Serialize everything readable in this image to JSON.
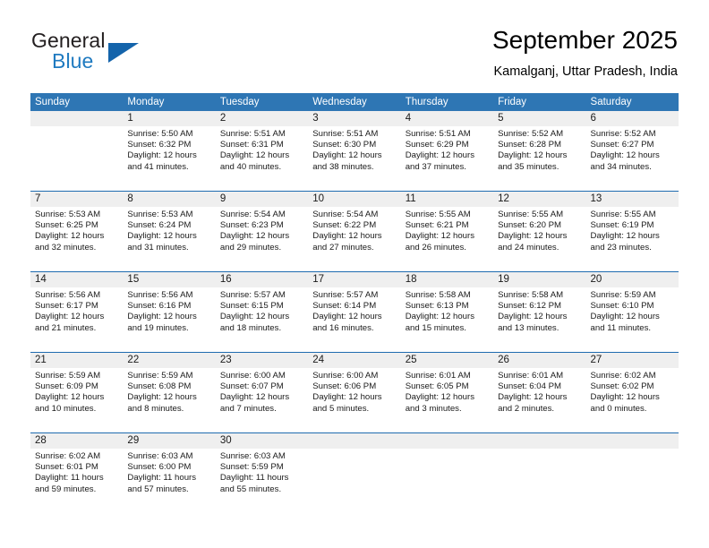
{
  "brand": {
    "name_part1": "General",
    "name_part2": "Blue",
    "triangle_icon": "triangle-logo-icon",
    "accent_color": "#1464ab",
    "blue_text_color": "#1f7ac0"
  },
  "header": {
    "title": "September 2025",
    "location": "Kamalganj, Uttar Pradesh, India"
  },
  "theme": {
    "header_band_color": "#2e76b4",
    "row_divider_color": "#1f6cb0",
    "daynum_strip_color": "#efefef",
    "text_color": "#1a1a1a"
  },
  "weekdays": [
    "Sunday",
    "Monday",
    "Tuesday",
    "Wednesday",
    "Thursday",
    "Friday",
    "Saturday"
  ],
  "weeks": [
    [
      {
        "day": "",
        "sunrise": "",
        "sunset": "",
        "daylight": "",
        "empty": true
      },
      {
        "day": "1",
        "sunrise": "Sunrise: 5:50 AM",
        "sunset": "Sunset: 6:32 PM",
        "daylight": "Daylight: 12 hours and 41 minutes."
      },
      {
        "day": "2",
        "sunrise": "Sunrise: 5:51 AM",
        "sunset": "Sunset: 6:31 PM",
        "daylight": "Daylight: 12 hours and 40 minutes."
      },
      {
        "day": "3",
        "sunrise": "Sunrise: 5:51 AM",
        "sunset": "Sunset: 6:30 PM",
        "daylight": "Daylight: 12 hours and 38 minutes."
      },
      {
        "day": "4",
        "sunrise": "Sunrise: 5:51 AM",
        "sunset": "Sunset: 6:29 PM",
        "daylight": "Daylight: 12 hours and 37 minutes."
      },
      {
        "day": "5",
        "sunrise": "Sunrise: 5:52 AM",
        "sunset": "Sunset: 6:28 PM",
        "daylight": "Daylight: 12 hours and 35 minutes."
      },
      {
        "day": "6",
        "sunrise": "Sunrise: 5:52 AM",
        "sunset": "Sunset: 6:27 PM",
        "daylight": "Daylight: 12 hours and 34 minutes."
      }
    ],
    [
      {
        "day": "7",
        "sunrise": "Sunrise: 5:53 AM",
        "sunset": "Sunset: 6:25 PM",
        "daylight": "Daylight: 12 hours and 32 minutes."
      },
      {
        "day": "8",
        "sunrise": "Sunrise: 5:53 AM",
        "sunset": "Sunset: 6:24 PM",
        "daylight": "Daylight: 12 hours and 31 minutes."
      },
      {
        "day": "9",
        "sunrise": "Sunrise: 5:54 AM",
        "sunset": "Sunset: 6:23 PM",
        "daylight": "Daylight: 12 hours and 29 minutes."
      },
      {
        "day": "10",
        "sunrise": "Sunrise: 5:54 AM",
        "sunset": "Sunset: 6:22 PM",
        "daylight": "Daylight: 12 hours and 27 minutes."
      },
      {
        "day": "11",
        "sunrise": "Sunrise: 5:55 AM",
        "sunset": "Sunset: 6:21 PM",
        "daylight": "Daylight: 12 hours and 26 minutes."
      },
      {
        "day": "12",
        "sunrise": "Sunrise: 5:55 AM",
        "sunset": "Sunset: 6:20 PM",
        "daylight": "Daylight: 12 hours and 24 minutes."
      },
      {
        "day": "13",
        "sunrise": "Sunrise: 5:55 AM",
        "sunset": "Sunset: 6:19 PM",
        "daylight": "Daylight: 12 hours and 23 minutes."
      }
    ],
    [
      {
        "day": "14",
        "sunrise": "Sunrise: 5:56 AM",
        "sunset": "Sunset: 6:17 PM",
        "daylight": "Daylight: 12 hours and 21 minutes."
      },
      {
        "day": "15",
        "sunrise": "Sunrise: 5:56 AM",
        "sunset": "Sunset: 6:16 PM",
        "daylight": "Daylight: 12 hours and 19 minutes."
      },
      {
        "day": "16",
        "sunrise": "Sunrise: 5:57 AM",
        "sunset": "Sunset: 6:15 PM",
        "daylight": "Daylight: 12 hours and 18 minutes."
      },
      {
        "day": "17",
        "sunrise": "Sunrise: 5:57 AM",
        "sunset": "Sunset: 6:14 PM",
        "daylight": "Daylight: 12 hours and 16 minutes."
      },
      {
        "day": "18",
        "sunrise": "Sunrise: 5:58 AM",
        "sunset": "Sunset: 6:13 PM",
        "daylight": "Daylight: 12 hours and 15 minutes."
      },
      {
        "day": "19",
        "sunrise": "Sunrise: 5:58 AM",
        "sunset": "Sunset: 6:12 PM",
        "daylight": "Daylight: 12 hours and 13 minutes."
      },
      {
        "day": "20",
        "sunrise": "Sunrise: 5:59 AM",
        "sunset": "Sunset: 6:10 PM",
        "daylight": "Daylight: 12 hours and 11 minutes."
      }
    ],
    [
      {
        "day": "21",
        "sunrise": "Sunrise: 5:59 AM",
        "sunset": "Sunset: 6:09 PM",
        "daylight": "Daylight: 12 hours and 10 minutes."
      },
      {
        "day": "22",
        "sunrise": "Sunrise: 5:59 AM",
        "sunset": "Sunset: 6:08 PM",
        "daylight": "Daylight: 12 hours and 8 minutes."
      },
      {
        "day": "23",
        "sunrise": "Sunrise: 6:00 AM",
        "sunset": "Sunset: 6:07 PM",
        "daylight": "Daylight: 12 hours and 7 minutes."
      },
      {
        "day": "24",
        "sunrise": "Sunrise: 6:00 AM",
        "sunset": "Sunset: 6:06 PM",
        "daylight": "Daylight: 12 hours and 5 minutes."
      },
      {
        "day": "25",
        "sunrise": "Sunrise: 6:01 AM",
        "sunset": "Sunset: 6:05 PM",
        "daylight": "Daylight: 12 hours and 3 minutes."
      },
      {
        "day": "26",
        "sunrise": "Sunrise: 6:01 AM",
        "sunset": "Sunset: 6:04 PM",
        "daylight": "Daylight: 12 hours and 2 minutes."
      },
      {
        "day": "27",
        "sunrise": "Sunrise: 6:02 AM",
        "sunset": "Sunset: 6:02 PM",
        "daylight": "Daylight: 12 hours and 0 minutes."
      }
    ],
    [
      {
        "day": "28",
        "sunrise": "Sunrise: 6:02 AM",
        "sunset": "Sunset: 6:01 PM",
        "daylight": "Daylight: 11 hours and 59 minutes."
      },
      {
        "day": "29",
        "sunrise": "Sunrise: 6:03 AM",
        "sunset": "Sunset: 6:00 PM",
        "daylight": "Daylight: 11 hours and 57 minutes."
      },
      {
        "day": "30",
        "sunrise": "Sunrise: 6:03 AM",
        "sunset": "Sunset: 5:59 PM",
        "daylight": "Daylight: 11 hours and 55 minutes."
      },
      {
        "day": "",
        "sunrise": "",
        "sunset": "",
        "daylight": "",
        "empty": true
      },
      {
        "day": "",
        "sunrise": "",
        "sunset": "",
        "daylight": "",
        "empty": true
      },
      {
        "day": "",
        "sunrise": "",
        "sunset": "",
        "daylight": "",
        "empty": true
      },
      {
        "day": "",
        "sunrise": "",
        "sunset": "",
        "daylight": "",
        "empty": true
      }
    ]
  ]
}
